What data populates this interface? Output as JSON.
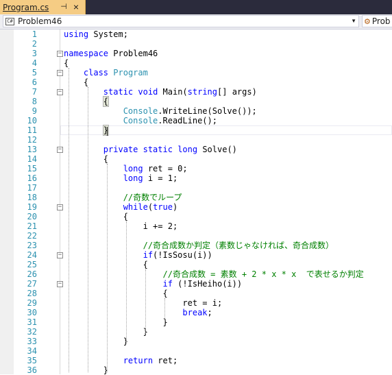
{
  "tab": {
    "title": "Program.cs",
    "pin_icon": "pin-icon",
    "close_icon": "close-icon"
  },
  "navbar": {
    "left_dropdown": "Problem46",
    "left_icon": "csharp-project-icon",
    "right_dropdown": "Prob",
    "right_icon": "class-icon"
  },
  "code": {
    "lines": [
      {
        "n": "1",
        "text": "using System;"
      },
      {
        "n": "2",
        "text": ""
      },
      {
        "n": "3",
        "text": "namespace Problem46"
      },
      {
        "n": "4",
        "text": "{"
      },
      {
        "n": "5",
        "text": "    class Program"
      },
      {
        "n": "6",
        "text": "    {"
      },
      {
        "n": "7",
        "text": "        static void Main(string[] args)"
      },
      {
        "n": "8",
        "text": "        {"
      },
      {
        "n": "9",
        "text": "            Console.WriteLine(Solve());"
      },
      {
        "n": "10",
        "text": "            Console.ReadLine();"
      },
      {
        "n": "11",
        "text": "        }"
      },
      {
        "n": "12",
        "text": ""
      },
      {
        "n": "13",
        "text": "        private static long Solve()"
      },
      {
        "n": "14",
        "text": "        {"
      },
      {
        "n": "15",
        "text": "            long ret = 0;"
      },
      {
        "n": "16",
        "text": "            long i = 1;"
      },
      {
        "n": "17",
        "text": ""
      },
      {
        "n": "18",
        "text": "            //奇数でループ"
      },
      {
        "n": "19",
        "text": "            while(true)"
      },
      {
        "n": "20",
        "text": "            {"
      },
      {
        "n": "21",
        "text": "                i += 2;"
      },
      {
        "n": "22",
        "text": ""
      },
      {
        "n": "23",
        "text": "                //奇合成数か判定（素数じゃなければ、奇合成数）"
      },
      {
        "n": "24",
        "text": "                if(!IsSosu(i))"
      },
      {
        "n": "25",
        "text": "                {"
      },
      {
        "n": "26",
        "text": "                    //奇合成数 = 素数 + 2 * x * x  で表せるか判定"
      },
      {
        "n": "27",
        "text": "                    if (!IsHeiho(i))"
      },
      {
        "n": "28",
        "text": "                    {"
      },
      {
        "n": "29",
        "text": "                        ret = i;"
      },
      {
        "n": "30",
        "text": "                        break;"
      },
      {
        "n": "31",
        "text": "                    }"
      },
      {
        "n": "32",
        "text": "                }"
      },
      {
        "n": "33",
        "text": "            }"
      },
      {
        "n": "34",
        "text": ""
      },
      {
        "n": "35",
        "text": "            return ret;"
      },
      {
        "n": "36",
        "text": "        }"
      }
    ]
  },
  "colors": {
    "keyword": "#0000ff",
    "type": "#2b91af",
    "comment": "#008000",
    "line_number": "#2b91af",
    "tab_active": "#f5cc84",
    "titlebar": "#2b2b3c"
  }
}
